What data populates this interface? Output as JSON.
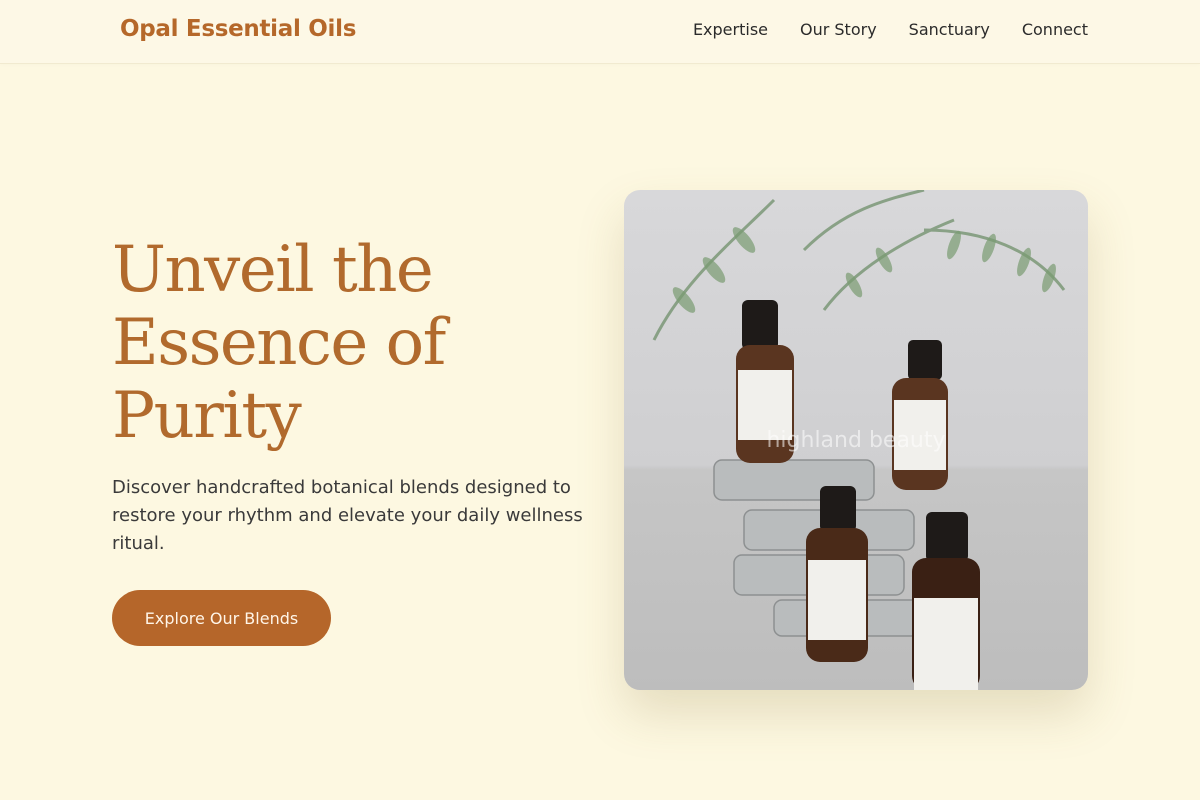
{
  "brand": {
    "name": "Opal Essential Oils",
    "accent": "#b5682a"
  },
  "nav": {
    "items": [
      "Expertise",
      "Our Story",
      "Sanctuary",
      "Connect"
    ]
  },
  "hero": {
    "title_lines": [
      "Unveil the",
      "Essence of",
      "Purity"
    ],
    "subtitle": "Discover handcrafted botanical blends designed to restore your rhythm and elevate your daily wellness ritual.",
    "cta_label": "Explore Our Blends",
    "image_alt": "highland beauty"
  },
  "colors": {
    "background": "#fdf8e1",
    "cta_bg": "#b5662a",
    "title": "#b16a2d"
  }
}
